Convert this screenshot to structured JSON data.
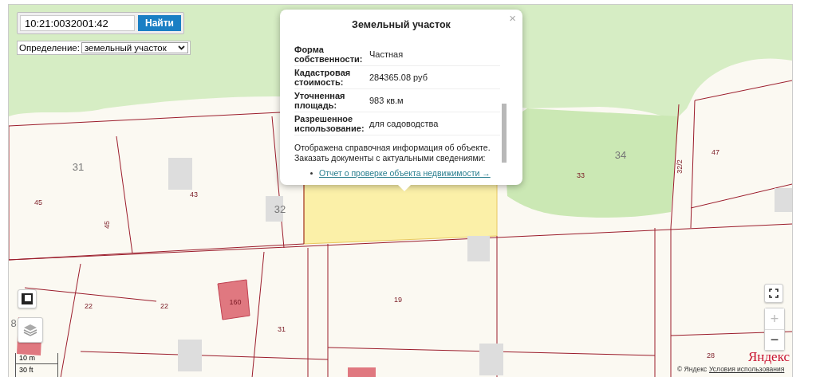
{
  "search": {
    "value": "10:21:0032001:42",
    "button": "Найти"
  },
  "definition": {
    "label": "Определение:",
    "value": "земельный участок"
  },
  "popup": {
    "title": "Земельный участок",
    "close": "×",
    "rows": [
      {
        "label": "Форма собственности:",
        "value": "Частная"
      },
      {
        "label": "Кадастровая стоимость:",
        "value": "284365.08 руб"
      },
      {
        "label": "Уточненная площадь:",
        "value": "983 кв.м"
      },
      {
        "label": "Разрешенное использование:",
        "value": "для садоводства"
      }
    ],
    "note": "Отображена справочная информация об объекте. Заказать документы с актуальными сведениями:",
    "link": "Отчет о проверке объекта недвижимости →"
  },
  "parcel_labels": [
    {
      "text": "31"
    },
    {
      "text": "45"
    },
    {
      "text": "45"
    },
    {
      "text": "43"
    },
    {
      "text": "32"
    },
    {
      "text": "34"
    },
    {
      "text": "33"
    },
    {
      "text": "32/2"
    },
    {
      "text": "47"
    },
    {
      "text": "22"
    },
    {
      "text": "22"
    },
    {
      "text": "160"
    },
    {
      "text": "19"
    },
    {
      "text": "31"
    },
    {
      "text": "8"
    },
    {
      "text": "28"
    }
  ],
  "scale": {
    "metric": "10 m",
    "imperial": "30 ft"
  },
  "zoom": {
    "plus": "+",
    "minus": "−",
    "plus_disabled": true
  },
  "brand": {
    "logo": "Яндекс",
    "copyright": "© Яндекс",
    "terms": "Условия использования"
  }
}
